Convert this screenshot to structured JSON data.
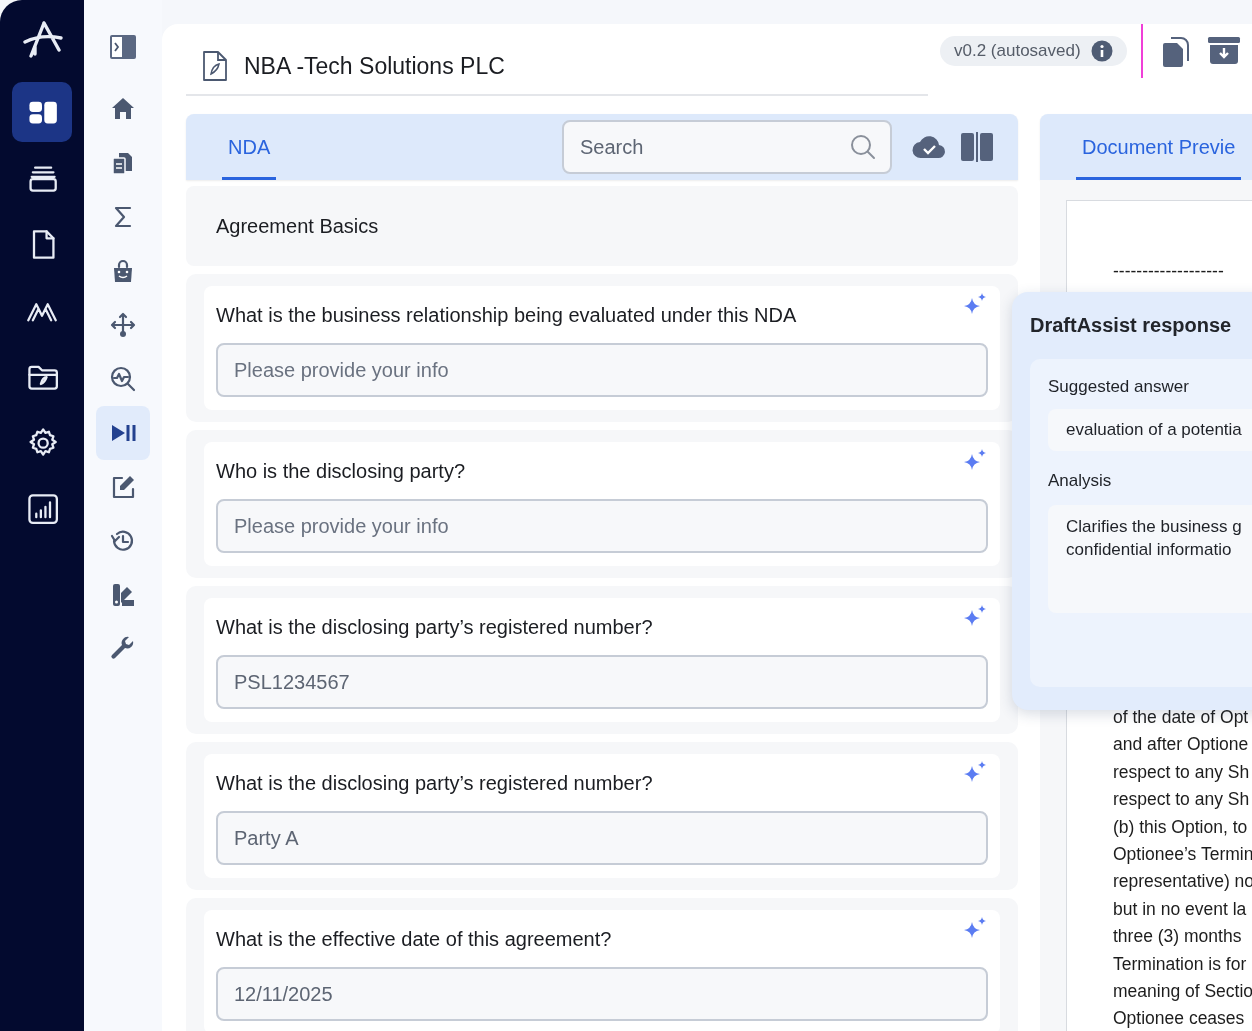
{
  "rail": {
    "items": [
      {
        "kind": "dashboard",
        "selected": true
      },
      {
        "kind": "stack",
        "selected": false
      },
      {
        "kind": "document",
        "selected": false
      },
      {
        "kind": "peaks",
        "selected": false
      },
      {
        "kind": "folder",
        "selected": false
      },
      {
        "kind": "gear",
        "selected": false
      },
      {
        "kind": "chart",
        "selected": false
      }
    ]
  },
  "sidebar": {
    "items": [
      {
        "kind": "home",
        "selected": false
      },
      {
        "kind": "copies",
        "selected": false
      },
      {
        "kind": "sigma",
        "selected": false
      },
      {
        "kind": "bag",
        "selected": false
      },
      {
        "kind": "arrows",
        "selected": false
      },
      {
        "kind": "pulse-search",
        "selected": false
      },
      {
        "kind": "play-pause",
        "selected": true
      },
      {
        "kind": "edit",
        "selected": false
      },
      {
        "kind": "history",
        "selected": false
      },
      {
        "kind": "swatches",
        "selected": false
      },
      {
        "kind": "wrench",
        "selected": false
      }
    ]
  },
  "header": {
    "title": "NBA -Tech Solutions PLC",
    "version": "v0.2 (autosaved)"
  },
  "form": {
    "tabs": [
      {
        "label": "NDA",
        "selected": true
      }
    ],
    "search": {
      "placeholder": "Search"
    },
    "section": "Agreement Basics",
    "questions": [
      {
        "label": "What is the business relationship being evaluated under this NDA",
        "placeholder": "Please provide your info"
      },
      {
        "label": "Who is the disclosing party?",
        "placeholder": "Please provide your info"
      },
      {
        "label": "What is the disclosing party’s registered number?",
        "value": "PSL1234567"
      },
      {
        "label": "What is the disclosing party’s registered number?",
        "value": "Party A"
      },
      {
        "label": "What is the effective date of this agreement?",
        "value": "12/11/2025"
      }
    ]
  },
  "preview": {
    "tabs": [
      {
        "label": "Document Previe",
        "selected": true
      }
    ],
    "rule": "-------------------",
    "lines": [
      "of the date of Opt",
      "and after Optione",
      "respect to any Sh",
      "respect to any Sh",
      "(b) this Option, to",
      "Optionee’s Termin",
      "representative) no",
      "but in no event la",
      "three (3) months",
      "Termination is for",
      "meaning of Sectio",
      "Optionee ceases"
    ]
  },
  "assist": {
    "title": "DraftAssist response",
    "suggested_label": "Suggested answer",
    "suggested": "evaluation of a potentia",
    "analysis_label": "Analysis",
    "analysis_lines": [
      "Clarifies the business g",
      "confidential informatio"
    ]
  }
}
